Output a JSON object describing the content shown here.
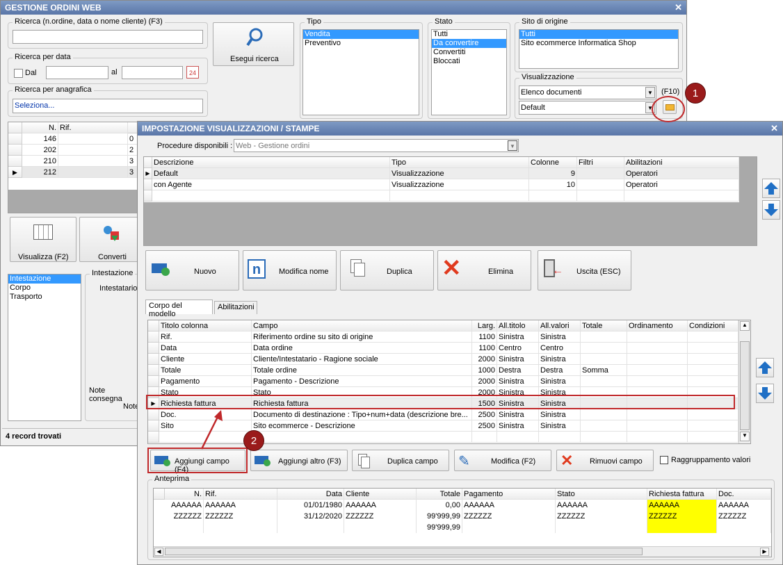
{
  "main": {
    "title": "GESTIONE ORDINI WEB",
    "search_label": "Ricerca (n.ordine, data o nome cliente) (F3)",
    "search_value": "",
    "date_label": "Ricerca per data",
    "date_from_label": "Dal",
    "date_to_label": "al",
    "anagrafica_label": "Ricerca per anagrafica",
    "anagrafica_value": "Seleziona...",
    "search_button": "Esegui ricerca",
    "tipo_label": "Tipo",
    "tipo_items": [
      "Vendita",
      "Preventivo"
    ],
    "stato_label": "Stato",
    "stato_items": [
      "Tutti",
      "Da convertire",
      "Convertiti",
      "Bloccati"
    ],
    "sito_label": "Sito di origine",
    "sito_items": [
      "Tutti",
      "Sito ecommerce Informatica Shop"
    ],
    "vis_label": "Visualizzazione",
    "vis_value1": "Elenco documenti",
    "vis_shortcut": "(F10)",
    "vis_value2": "Default",
    "grid_headers": [
      "N.",
      "Rif."
    ],
    "grid_rows": [
      {
        "n": "146",
        "extra": "0"
      },
      {
        "n": "202",
        "extra": "2"
      },
      {
        "n": "210",
        "extra": "3"
      },
      {
        "n": "212",
        "extra": "3"
      }
    ],
    "btn_visualizza": "Visualizza (F2)",
    "btn_converti": "Converti",
    "left_list": [
      "Intestazione",
      "Corpo",
      "Trasporto"
    ],
    "intestazione_label": "Intestazione",
    "intestatario_label": "Intestatario",
    "note_consegna_label": "Note consegna",
    "note_label": "Note",
    "status": "4 record trovati"
  },
  "dialog": {
    "title": "IMPOSTAZIONE VISUALIZZAZIONI / STAMPE",
    "procedure_label": "Procedure disponibili :",
    "procedure_value": "Web - Gestione ordini",
    "top_headers": [
      "Descrizione",
      "Tipo",
      "Colonne",
      "Filtri",
      "Abilitazioni"
    ],
    "top_rows": [
      {
        "descrizione": "Default",
        "tipo": "Visualizzazione",
        "colonne": "9",
        "filtri": "",
        "abilitazioni": "Operatori"
      },
      {
        "descrizione": "con Agente",
        "tipo": "Visualizzazione",
        "colonne": "10",
        "filtri": "",
        "abilitazioni": "Operatori"
      }
    ],
    "btn_nuovo": "Nuovo",
    "btn_modifica_nome": "Modifica nome",
    "btn_duplica": "Duplica",
    "btn_elimina": "Elimina",
    "btn_uscita": "Uscita (ESC)",
    "tab1": "Corpo del modello",
    "tab2": "Abilitazioni",
    "field_headers": [
      "Titolo colonna",
      "Campo",
      "Larg.",
      "All.titolo",
      "All.valori",
      "Totale",
      "Ordinamento",
      "Condizioni"
    ],
    "field_rows": [
      {
        "titolo": "Rif.",
        "campo": "Riferimento ordine su sito di origine",
        "larg": "1100",
        "alltitolo": "Sinistra",
        "allvalori": "Sinistra",
        "totale": ""
      },
      {
        "titolo": "Data",
        "campo": "Data ordine",
        "larg": "1100",
        "alltitolo": "Centro",
        "allvalori": "Centro",
        "totale": ""
      },
      {
        "titolo": "Cliente",
        "campo": "Cliente/Intestatario - Ragione sociale",
        "larg": "2000",
        "alltitolo": "Sinistra",
        "allvalori": "Sinistra",
        "totale": ""
      },
      {
        "titolo": "Totale",
        "campo": "Totale ordine",
        "larg": "1000",
        "alltitolo": "Destra",
        "allvalori": "Destra",
        "totale": "Somma"
      },
      {
        "titolo": "Pagamento",
        "campo": "Pagamento - Descrizione",
        "larg": "2000",
        "alltitolo": "Sinistra",
        "allvalori": "Sinistra",
        "totale": ""
      },
      {
        "titolo": "Stato",
        "campo": "Stato",
        "larg": "2000",
        "alltitolo": "Sinistra",
        "allvalori": "Sinistra",
        "totale": ""
      },
      {
        "titolo": "Richiesta fattura",
        "campo": "Richiesta fattura",
        "larg": "1500",
        "alltitolo": "Sinistra",
        "allvalori": "Sinistra",
        "totale": ""
      },
      {
        "titolo": "Doc.",
        "campo": "Documento di destinazione : Tipo+num+data (descrizione bre...",
        "larg": "2500",
        "alltitolo": "Sinistra",
        "allvalori": "Sinistra",
        "totale": ""
      },
      {
        "titolo": "Sito",
        "campo": "Sito ecommerce - Descrizione",
        "larg": "2500",
        "alltitolo": "Sinistra",
        "allvalori": "Sinistra",
        "totale": ""
      }
    ],
    "btn_aggiungi": "Aggiungi campo (F4)",
    "btn_aggiungi_altro": "Aggiungi altro (F3)",
    "btn_duplica_campo": "Duplica campo",
    "btn_modifica": "Modifica (F2)",
    "btn_rimuovi": "Rimuovi campo",
    "raggruppamento_label": "Raggruppamento valori",
    "anteprima_label": "Anteprima",
    "preview_headers": [
      "N.",
      "Rif.",
      "Data",
      "Cliente",
      "Totale",
      "Pagamento",
      "Stato",
      "Richiesta fattura",
      "Doc."
    ],
    "preview_rows": [
      [
        "AAAAAA",
        "AAAAAA",
        "01/01/1980",
        "AAAAAA",
        "0,00",
        "AAAAAA",
        "AAAAAA",
        "AAAAAA",
        "AAAAAA"
      ],
      [
        "ZZZZZZ",
        "ZZZZZZ",
        "31/12/2020",
        "ZZZZZZ",
        "99'999,99",
        "ZZZZZZ",
        "ZZZZZZ",
        "ZZZZZZ",
        "ZZZZZZ"
      ],
      [
        "",
        "",
        "",
        "",
        "99'999,99",
        "",
        "",
        "",
        ""
      ]
    ]
  },
  "annotations": {
    "badge1": "1",
    "badge2": "2"
  },
  "colors": {
    "selection": "#3399ff",
    "highlight_column": "#ffff00",
    "annotation_red": "#c0282a"
  }
}
